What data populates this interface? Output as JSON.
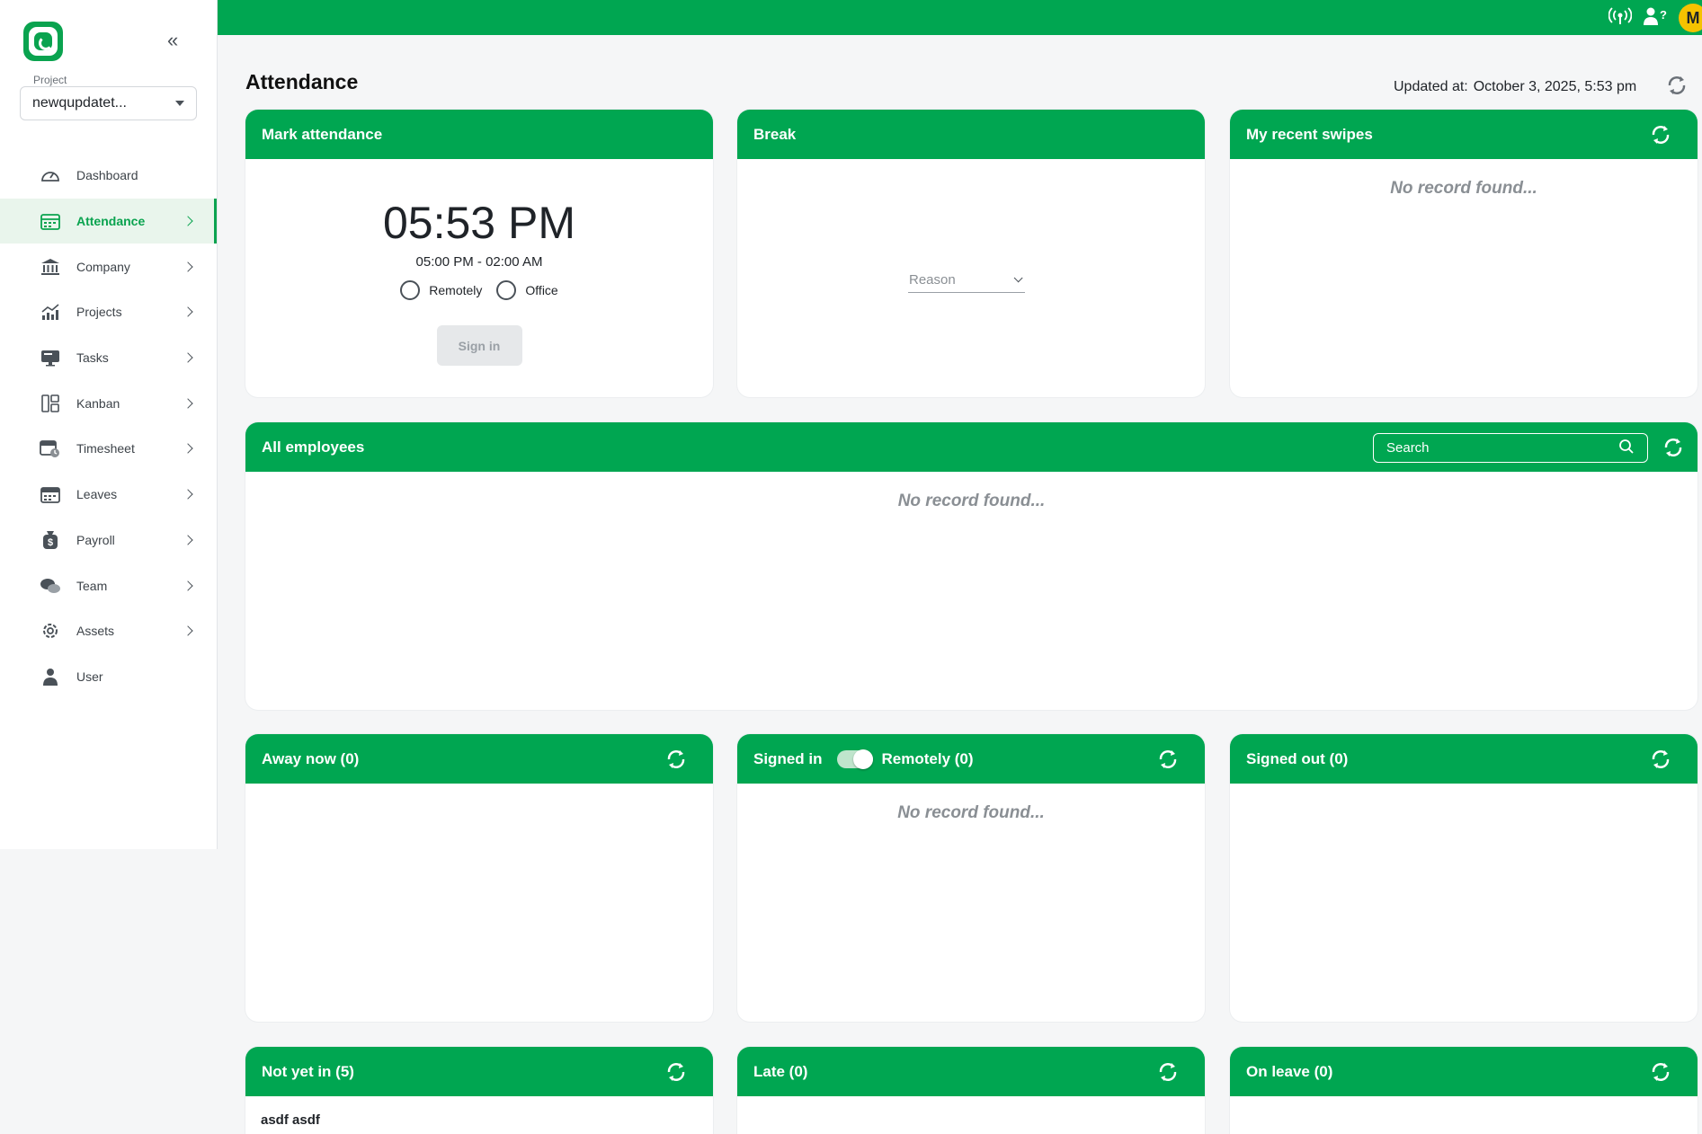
{
  "sidebar": {
    "project_label": "Project",
    "project_value": "newqupdatet...",
    "items": [
      {
        "label": "Dashboard",
        "icon": "gauge-icon",
        "chevron": false
      },
      {
        "label": "Attendance",
        "icon": "calendar-grid-icon",
        "chevron": true,
        "active": true
      },
      {
        "label": "Company",
        "icon": "bank-icon",
        "chevron": true
      },
      {
        "label": "Projects",
        "icon": "chart-icon",
        "chevron": true
      },
      {
        "label": "Tasks",
        "icon": "monitor-icon",
        "chevron": true
      },
      {
        "label": "Kanban",
        "icon": "kanban-icon",
        "chevron": true
      },
      {
        "label": "Timesheet",
        "icon": "calendar-clock-icon",
        "chevron": true
      },
      {
        "label": "Leaves",
        "icon": "calendar-icon",
        "chevron": true
      },
      {
        "label": "Payroll",
        "icon": "money-bag-icon",
        "chevron": true
      },
      {
        "label": "Team",
        "icon": "chat-bubbles-icon",
        "chevron": true
      },
      {
        "label": "Assets",
        "icon": "gear-icon",
        "chevron": true
      },
      {
        "label": "User",
        "icon": "user-icon",
        "chevron": false
      }
    ]
  },
  "topbar": {
    "avatar_initial": "M",
    "accent": "#00a651"
  },
  "page": {
    "title": "Attendance",
    "updated_label": "Updated at:",
    "updated_value": "October 3, 2025, 5:53 pm"
  },
  "mark_attendance": {
    "title": "Mark attendance",
    "time": "05:53 PM",
    "shift": "05:00 PM - 02:00 AM",
    "option_remote": "Remotely",
    "option_office": "Office",
    "signin_label": "Sign in"
  },
  "break": {
    "title": "Break",
    "reason_placeholder": "Reason"
  },
  "recent_swipes": {
    "title": "My recent swipes",
    "empty": "No record found..."
  },
  "all_employees": {
    "title": "All employees",
    "search_placeholder": "Search",
    "empty": "No record found..."
  },
  "away_now": {
    "title": "Away now (0)"
  },
  "signed_in": {
    "title": "Signed in",
    "toggle_label": "Remotely (0)",
    "empty": "No record found..."
  },
  "signed_out": {
    "title": "Signed out (0)"
  },
  "not_yet_in": {
    "title": "Not yet in (5)",
    "first_row": "asdf asdf"
  },
  "late": {
    "title": "Late (0)"
  },
  "on_leave": {
    "title": "On leave (0)"
  }
}
